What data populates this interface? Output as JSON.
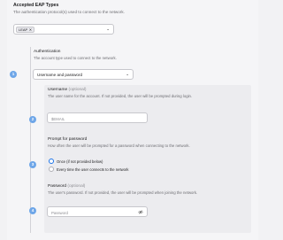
{
  "eap": {
    "title": "Accepted EAP Types",
    "description": "The authentication protocol(s) used to connect to the network.",
    "selected_tag": "LEAP",
    "tag_remove": "✕"
  },
  "auth": {
    "step": "1",
    "title": "Authentication",
    "description": "The account type used to connect to the network.",
    "selected": "Username and password"
  },
  "username": {
    "step": "2",
    "title": "Username",
    "optional": "(optional)",
    "description": "The user name for the account. If not provided, the user will be prompted during login.",
    "placeholder": "$EMAIL"
  },
  "prompt": {
    "step": "3",
    "title": "Prompt for password",
    "description": "How often the user will be prompted for a password when connecting to the network.",
    "options": [
      {
        "label": "Once (if not provided below)",
        "selected": true
      },
      {
        "label": "Every time the user connects to the network",
        "selected": false
      }
    ]
  },
  "password": {
    "step": "4",
    "title": "Password",
    "optional": "(optional)",
    "description": "The user's password. If not provided, the user will be prompted when joining the network.",
    "placeholder": "Password"
  },
  "colors": {
    "accent": "#1a73e8",
    "step_badge": "#6ea6e8"
  }
}
